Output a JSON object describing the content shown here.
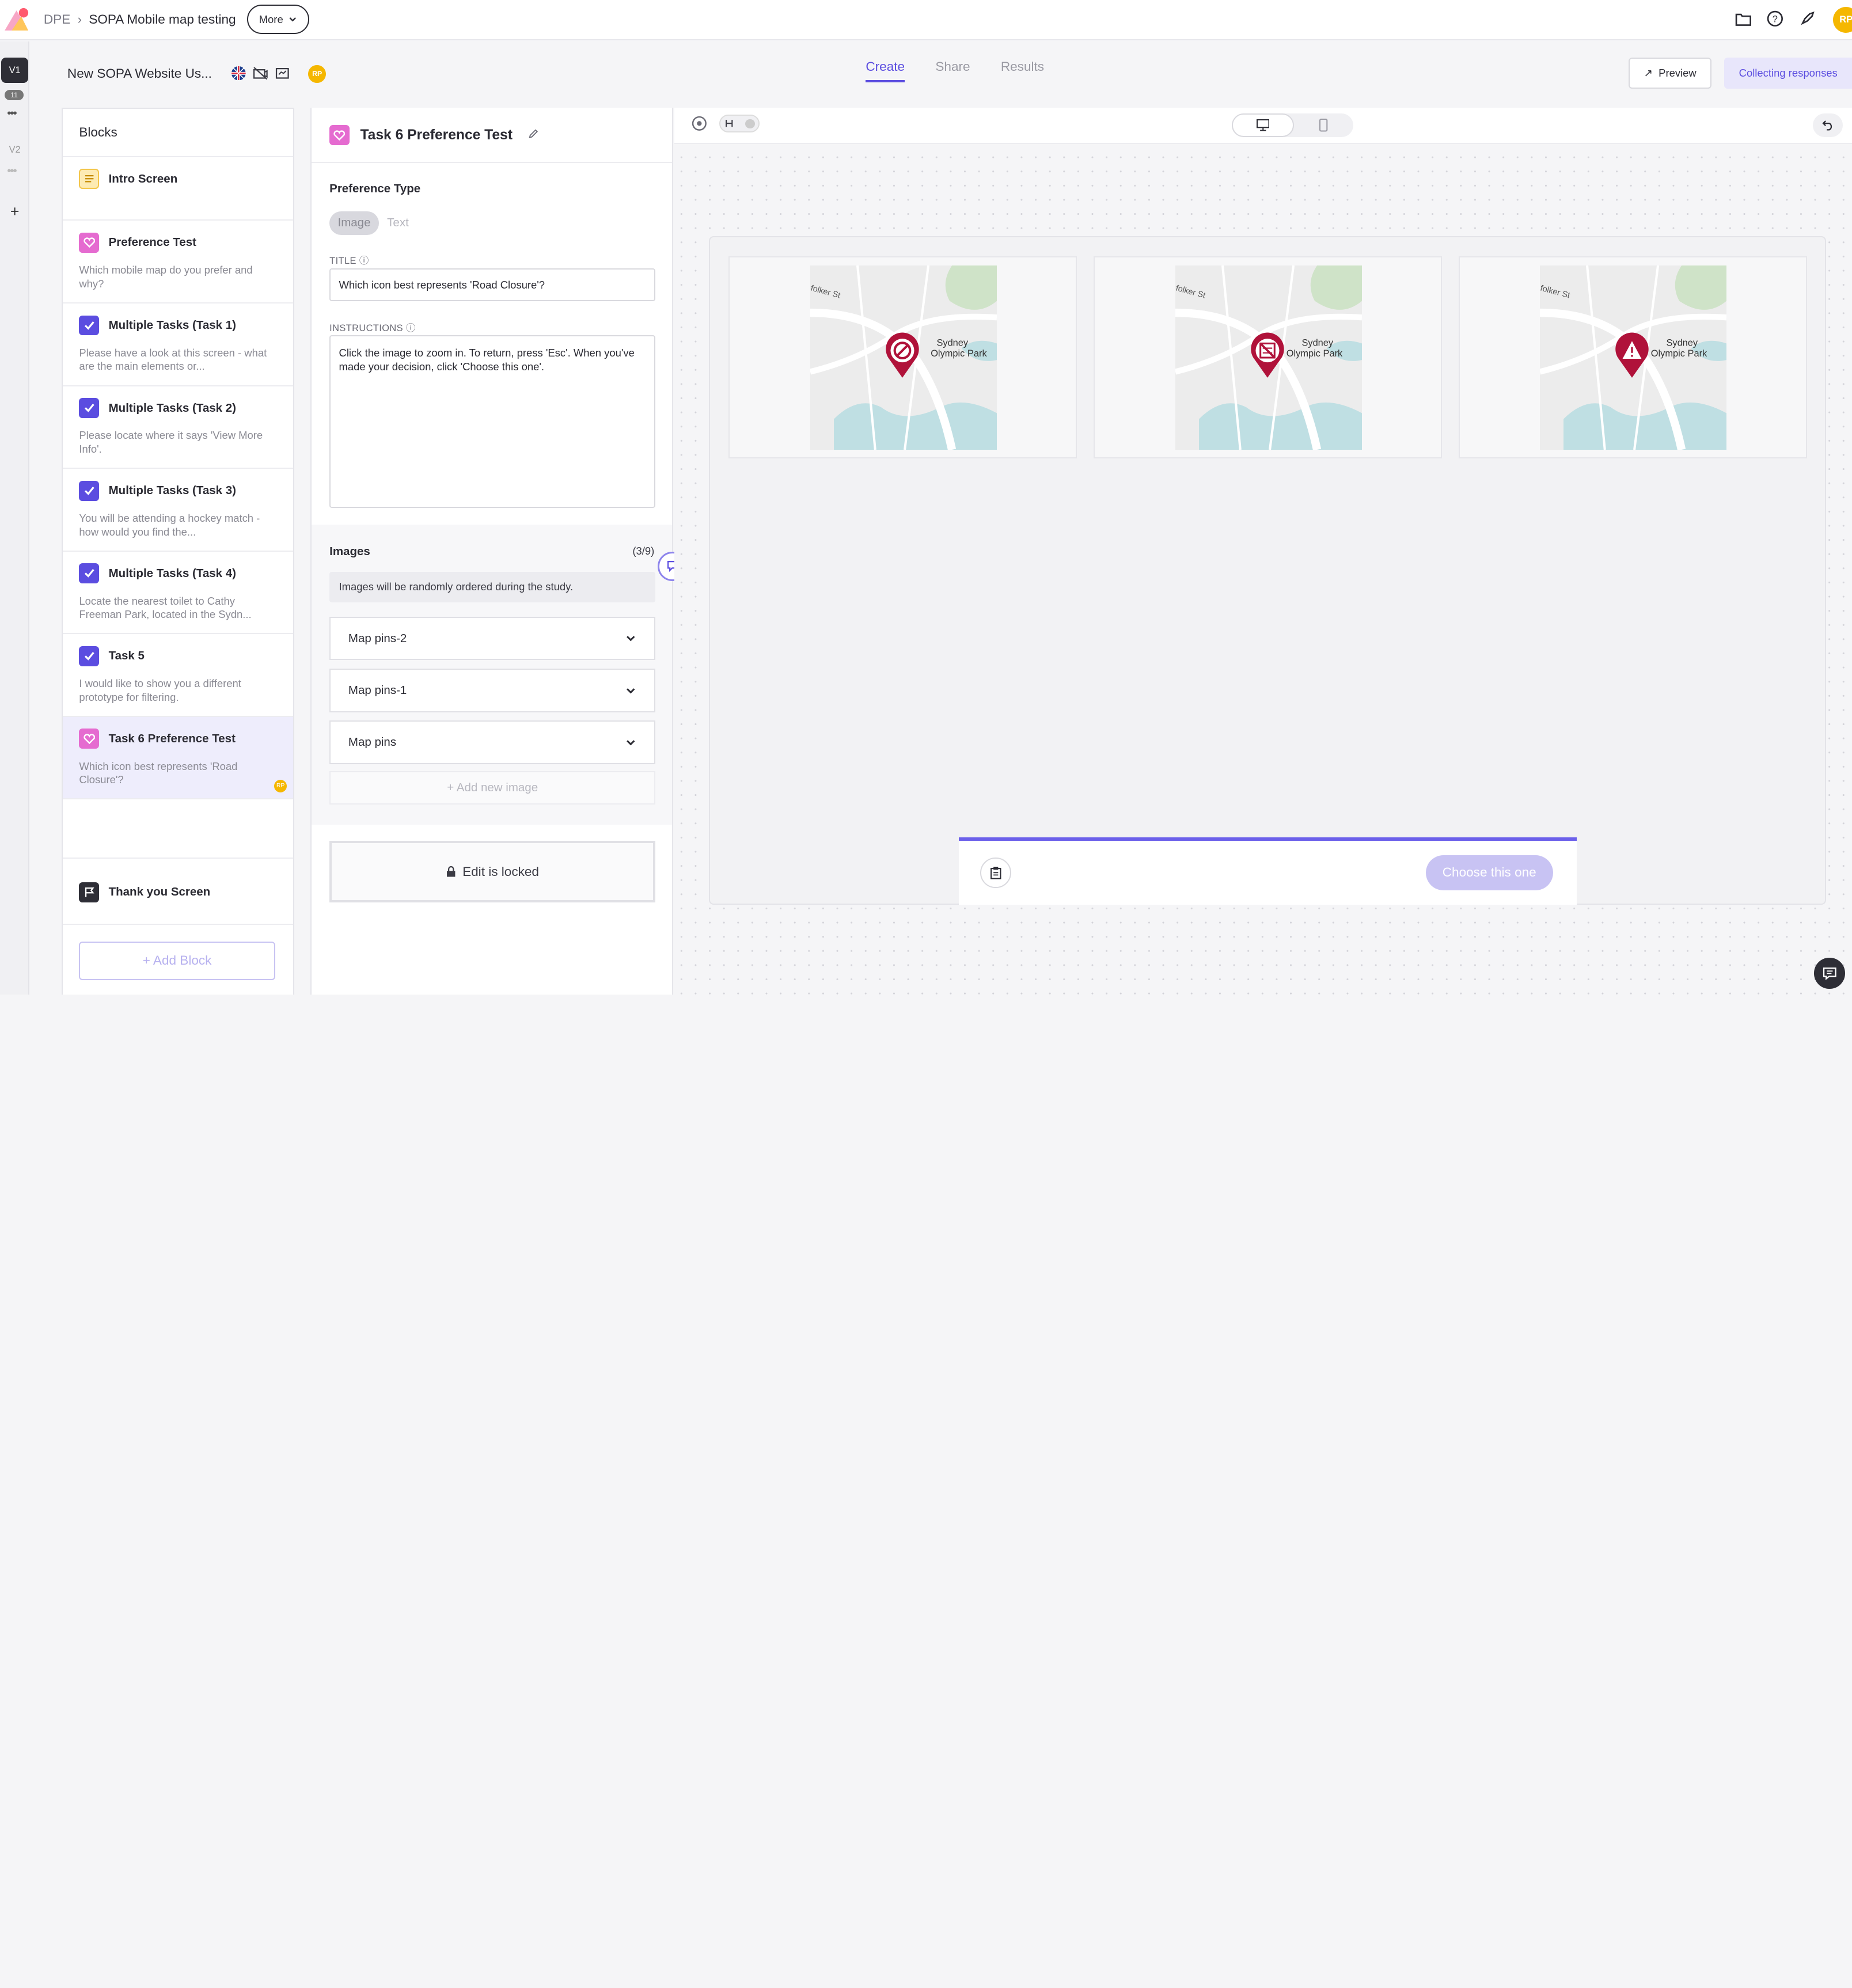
{
  "breadcrumb": {
    "root": "DPE",
    "project": "SOPA Mobile map testing",
    "more": "More"
  },
  "topbar_icons": [
    "folder-icon",
    "help-icon",
    "rocket-icon"
  ],
  "user_initials": "RP",
  "versions": {
    "v1": "V1",
    "v1_count": "11",
    "v2": "V2",
    "add": "+"
  },
  "study": {
    "title": "New SOPA Website Us...",
    "avatar": "RP"
  },
  "tabs": [
    "Create",
    "Share",
    "Results"
  ],
  "active_tab": "Create",
  "header_buttons": {
    "preview": "Preview",
    "collecting": "Collecting responses"
  },
  "blocks": {
    "heading": "Blocks",
    "items": [
      {
        "icon": "intro-icon",
        "title": "Intro Screen",
        "desc": ""
      },
      {
        "icon": "heart-icon",
        "title": "Preference Test",
        "desc": "Which mobile map do you prefer and why?"
      },
      {
        "icon": "checkbox-icon",
        "title": "Multiple Tasks (Task 1)",
        "desc": "Please have a look at this screen - what are the main elements or..."
      },
      {
        "icon": "checkbox-icon",
        "title": "Multiple Tasks (Task 2)",
        "desc": "Please locate where it says 'View More Info'."
      },
      {
        "icon": "checkbox-icon",
        "title": "Multiple Tasks (Task 3)",
        "desc": "You will be attending a hockey match - how would you find the..."
      },
      {
        "icon": "checkbox-icon",
        "title": "Multiple Tasks (Task 4)",
        "desc": "Locate the nearest toilet to Cathy Freeman Park, located in the Sydn..."
      },
      {
        "icon": "checkbox-icon",
        "title": "Task 5",
        "desc": "I would like to show you a different prototype for filtering."
      },
      {
        "icon": "heart-icon",
        "title": "Task 6 Preference Test",
        "desc": "Which icon best represents 'Road Closure'?"
      },
      {
        "icon": "flag-icon",
        "title": "Thank you Screen",
        "desc": ""
      }
    ],
    "add_block": "+ Add Block"
  },
  "editor": {
    "title": "Task 6 Preference Test",
    "preference_type_label": "Preference Type",
    "type_options": [
      "Image",
      "Text"
    ],
    "selected_type": "Image",
    "title_label": "TITLE",
    "title_value": "Which icon best represents 'Road Closure'?",
    "instructions_label": "INSTRUCTIONS",
    "instructions_value": "Click the image to zoom in. To return, press 'Esc'. When you've made your decision, click 'Choose this one'.",
    "images_label": "Images",
    "images_count": "(3/9)",
    "images_info": "Images will be randomly ordered during the study.",
    "images": [
      "Map pins-2",
      "Map pins-1",
      "Map pins"
    ],
    "add_image": "+ Add new image",
    "locked_text": "Edit is locked"
  },
  "preview": {
    "map_labels": {
      "place": "Sydney",
      "place2": "Olympic Park"
    },
    "pin_icons": [
      "no-entry-icon",
      "road-closed-icon",
      "warning-icon"
    ],
    "choose_button": "Choose this one"
  },
  "colors": {
    "accent": "#5b4de0",
    "pin": "#b0123a",
    "pink": "#e56bd0"
  }
}
